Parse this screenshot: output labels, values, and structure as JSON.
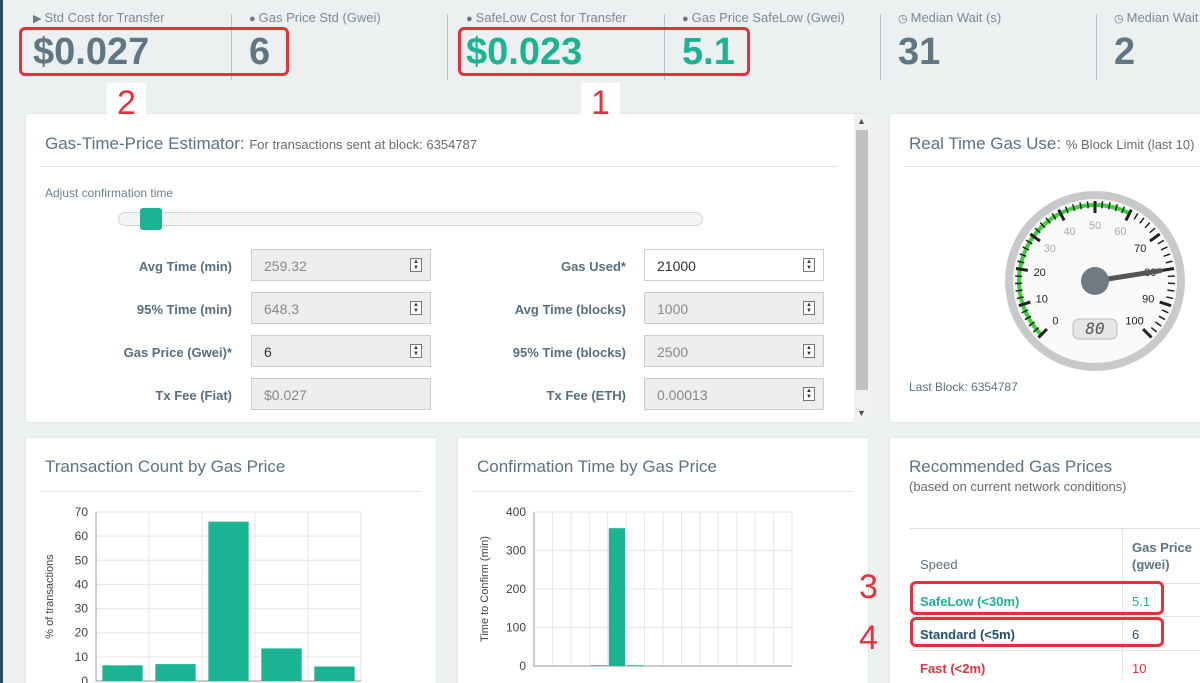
{
  "top_stats": [
    {
      "icon": "transfer-icon",
      "label": "Std Cost for Transfer",
      "value": "$0.027"
    },
    {
      "icon": "gauge-icon",
      "label": "Gas Price Std (Gwei)",
      "value": "6"
    },
    {
      "icon": "gauge-icon",
      "label": "SafeLow Cost for Transfer",
      "value": "$0.023"
    },
    {
      "icon": "gauge-icon",
      "label": "Gas Price SafeLow (Gwei)",
      "value": "5.1"
    },
    {
      "icon": "clock-icon",
      "label": "Median Wait (s)",
      "value": "31"
    },
    {
      "icon": "clock-icon",
      "label": "Median Wait",
      "value": "2"
    }
  ],
  "annotations": {
    "one": "1",
    "two": "2",
    "three": "3",
    "four": "4"
  },
  "estimator": {
    "title": "Gas-Time-Price Estimator:",
    "subtitle": "For transactions sent at block: 6354787",
    "slider_label": "Adjust confirmation time",
    "slider_position": 0.04,
    "fields": {
      "avg_time_min": {
        "label": "Avg Time (min)",
        "value": "259.32"
      },
      "time95_min": {
        "label": "95% Time (min)",
        "value": "648.3"
      },
      "gas_price": {
        "label": "Gas Price (Gwei)*",
        "value": "6"
      },
      "tx_fee_fiat": {
        "label": "Tx Fee (Fiat)",
        "value": "$0.027"
      },
      "gas_used": {
        "label": "Gas Used*",
        "value": "21000"
      },
      "avg_time_blocks": {
        "label": "Avg Time (blocks)",
        "value": "1000"
      },
      "time95_blocks": {
        "label": "95% Time (blocks)",
        "value": "2500"
      },
      "tx_fee_eth": {
        "label": "Tx Fee (ETH)",
        "value": "0.00013"
      }
    }
  },
  "gas_use": {
    "title": "Real Time Gas Use:",
    "subtitle": "% Block Limit (last 10)",
    "last_block": "Last Block: 6354787",
    "gauge_value": 80,
    "gauge_display": "80",
    "gauge_ticks": [
      "0",
      "10",
      "20",
      "30",
      "40",
      "50",
      "60",
      "70",
      "80",
      "90",
      "100"
    ]
  },
  "tx_count_chart": {
    "title": "Transaction Count by Gas Price",
    "chart_data": {
      "type": "bar",
      "ylabel": "% of transactions",
      "ylim": [
        0,
        70
      ],
      "yticks": [
        "70",
        "60",
        "50",
        "40",
        "30",
        "20",
        "10",
        "0"
      ],
      "values": [
        6.5,
        7,
        66,
        13.5,
        6
      ]
    }
  },
  "conf_time_chart": {
    "title": "Confirmation Time by Gas Price",
    "chart_data": {
      "type": "bar",
      "ylabel": "Time to Confirm (min)",
      "ylim": [
        0,
        400
      ],
      "yticks": [
        "400",
        "300",
        "200",
        "100",
        "0"
      ],
      "values": [
        0,
        0,
        0,
        2,
        358,
        2,
        0,
        0,
        0,
        0,
        0,
        0,
        0,
        0
      ]
    }
  },
  "recommended": {
    "title": "Recommended Gas Prices",
    "subtitle": "(based on current network conditions)",
    "col_speed": "Speed",
    "col_price_1": "Gas Price",
    "col_price_2": "(gwei)",
    "rows": [
      {
        "speed": "SafeLow (<30m)",
        "price": "5.1",
        "color": "#1ab394"
      },
      {
        "speed": "Standard (<5m)",
        "price": "6",
        "color": "#1f4e6e"
      },
      {
        "speed": "Fast (<2m)",
        "price": "10",
        "color": "#e8303a"
      }
    ]
  },
  "colors": {
    "accent": "#1ab394",
    "highlight": "#e8303a",
    "muted": "#607684"
  }
}
